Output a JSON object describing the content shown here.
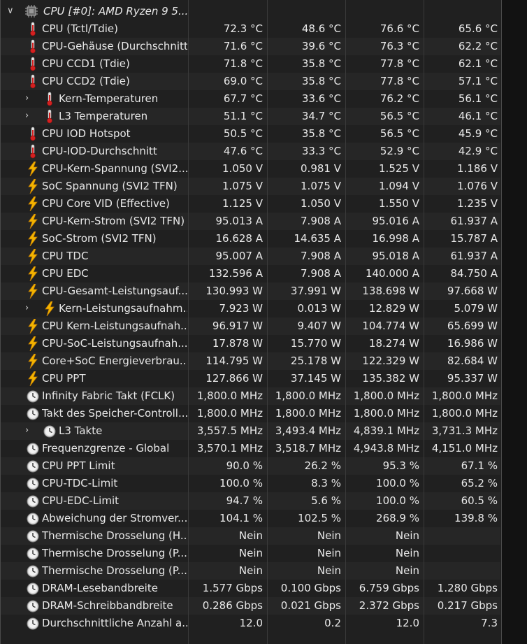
{
  "header": {
    "title": "CPU [#0]: AMD Ryzen 9 5..."
  },
  "rows": [
    {
      "name": "CPU (Tctl/Tdie)",
      "icon": "thermometer",
      "indent": 0,
      "v": [
        "72.3 °C",
        "48.6 °C",
        "76.6 °C",
        "65.6 °C"
      ]
    },
    {
      "name": "CPU-Gehäuse (Durchschnitt)",
      "icon": "thermometer",
      "indent": 0,
      "v": [
        "71.6 °C",
        "39.6 °C",
        "76.3 °C",
        "62.2 °C"
      ]
    },
    {
      "name": "CPU CCD1 (Tdie)",
      "icon": "thermometer",
      "indent": 0,
      "v": [
        "71.8 °C",
        "35.8 °C",
        "77.8 °C",
        "62.1 °C"
      ]
    },
    {
      "name": "CPU CCD2 (Tdie)",
      "icon": "thermometer",
      "indent": 0,
      "v": [
        "69.0 °C",
        "35.8 °C",
        "77.8 °C",
        "57.1 °C"
      ]
    },
    {
      "name": "Kern-Temperaturen",
      "icon": "thermometer",
      "indent": 1,
      "v": [
        "67.7 °C",
        "33.6 °C",
        "76.2 °C",
        "56.1 °C"
      ]
    },
    {
      "name": "L3 Temperaturen",
      "icon": "thermometer",
      "indent": 1,
      "v": [
        "51.1 °C",
        "34.7 °C",
        "56.5 °C",
        "46.1 °C"
      ]
    },
    {
      "name": "CPU IOD Hotspot",
      "icon": "thermometer",
      "indent": 0,
      "v": [
        "50.5 °C",
        "35.8 °C",
        "56.5 °C",
        "45.9 °C"
      ]
    },
    {
      "name": "CPU-IOD-Durchschnitt",
      "icon": "thermometer",
      "indent": 0,
      "v": [
        "47.6 °C",
        "33.3 °C",
        "52.9 °C",
        "42.9 °C"
      ]
    },
    {
      "name": "CPU-Kern-Spannung (SVI2...",
      "icon": "lightning",
      "indent": 0,
      "v": [
        "1.050 V",
        "0.981 V",
        "1.525 V",
        "1.186 V"
      ]
    },
    {
      "name": "SoC Spannung (SVI2 TFN)",
      "icon": "lightning",
      "indent": 0,
      "v": [
        "1.075 V",
        "1.075 V",
        "1.094 V",
        "1.076 V"
      ]
    },
    {
      "name": "CPU Core VID (Effective)",
      "icon": "lightning",
      "indent": 0,
      "v": [
        "1.125 V",
        "1.050 V",
        "1.550 V",
        "1.235 V"
      ]
    },
    {
      "name": "CPU-Kern-Strom (SVI2 TFN)",
      "icon": "lightning",
      "indent": 0,
      "v": [
        "95.013 A",
        "7.908 A",
        "95.016 A",
        "61.937 A"
      ]
    },
    {
      "name": "SoC-Strom (SVI2 TFN)",
      "icon": "lightning",
      "indent": 0,
      "v": [
        "16.628 A",
        "14.635 A",
        "16.998 A",
        "15.787 A"
      ]
    },
    {
      "name": "CPU TDC",
      "icon": "lightning",
      "indent": 0,
      "v": [
        "95.007 A",
        "7.908 A",
        "95.018 A",
        "61.937 A"
      ]
    },
    {
      "name": "CPU EDC",
      "icon": "lightning",
      "indent": 0,
      "v": [
        "132.596 A",
        "7.908 A",
        "140.000 A",
        "84.750 A"
      ]
    },
    {
      "name": "CPU-Gesamt-Leistungsauf...",
      "icon": "lightning",
      "indent": 0,
      "v": [
        "130.993 W",
        "37.991 W",
        "138.698 W",
        "97.668 W"
      ]
    },
    {
      "name": "Kern-Leistungsaufnahm...",
      "icon": "lightning",
      "indent": 1,
      "v": [
        "7.923 W",
        "0.013 W",
        "12.829 W",
        "5.079 W"
      ]
    },
    {
      "name": "CPU Kern-Leistungsaufnah...",
      "icon": "lightning",
      "indent": 0,
      "v": [
        "96.917 W",
        "9.407 W",
        "104.774 W",
        "65.699 W"
      ]
    },
    {
      "name": "CPU-SoC-Leistungsaufnah...",
      "icon": "lightning",
      "indent": 0,
      "v": [
        "17.878 W",
        "15.770 W",
        "18.274 W",
        "16.986 W"
      ]
    },
    {
      "name": "Core+SoC Energieverbrau...",
      "icon": "lightning",
      "indent": 0,
      "v": [
        "114.795 W",
        "25.178 W",
        "122.329 W",
        "82.684 W"
      ]
    },
    {
      "name": "CPU PPT",
      "icon": "lightning",
      "indent": 0,
      "v": [
        "127.866 W",
        "37.145 W",
        "135.382 W",
        "95.337 W"
      ]
    },
    {
      "name": "Infinity Fabric Takt (FCLK)",
      "icon": "clock",
      "indent": 0,
      "v": [
        "1,800.0 MHz",
        "1,800.0 MHz",
        "1,800.0 MHz",
        "1,800.0 MHz"
      ]
    },
    {
      "name": "Takt des Speicher-Controll...",
      "icon": "clock",
      "indent": 0,
      "v": [
        "1,800.0 MHz",
        "1,800.0 MHz",
        "1,800.0 MHz",
        "1,800.0 MHz"
      ]
    },
    {
      "name": "L3 Takte",
      "icon": "clock",
      "indent": 1,
      "v": [
        "3,557.5 MHz",
        "3,493.4 MHz",
        "4,839.1 MHz",
        "3,731.3 MHz"
      ]
    },
    {
      "name": "Frequenzgrenze - Global",
      "icon": "clock",
      "indent": 0,
      "v": [
        "3,570.1 MHz",
        "3,518.7 MHz",
        "4,943.8 MHz",
        "4,151.0 MHz"
      ]
    },
    {
      "name": "CPU PPT Limit",
      "icon": "clock",
      "indent": 0,
      "v": [
        "90.0 %",
        "26.2 %",
        "95.3 %",
        "67.1 %"
      ]
    },
    {
      "name": "CPU-TDC-Limit",
      "icon": "clock",
      "indent": 0,
      "v": [
        "100.0 %",
        "8.3 %",
        "100.0 %",
        "65.2 %"
      ]
    },
    {
      "name": "CPU-EDC-Limit",
      "icon": "clock",
      "indent": 0,
      "v": [
        "94.7 %",
        "5.6 %",
        "100.0 %",
        "60.5 %"
      ]
    },
    {
      "name": "Abweichung der Stromver...",
      "icon": "clock",
      "indent": 0,
      "v": [
        "104.1 %",
        "102.5 %",
        "268.9 %",
        "139.8 %"
      ]
    },
    {
      "name": "Thermische Drosselung (H...",
      "icon": "clock",
      "indent": 0,
      "v": [
        "Nein",
        "Nein",
        "Nein",
        ""
      ]
    },
    {
      "name": "Thermische Drosselung (P...",
      "icon": "clock",
      "indent": 0,
      "v": [
        "Nein",
        "Nein",
        "Nein",
        ""
      ]
    },
    {
      "name": "Thermische Drosselung (P...",
      "icon": "clock",
      "indent": 0,
      "v": [
        "Nein",
        "Nein",
        "Nein",
        ""
      ]
    },
    {
      "name": "DRAM-Lesebandbreite",
      "icon": "clock",
      "indent": 0,
      "v": [
        "1.577 Gbps",
        "0.100 Gbps",
        "6.759 Gbps",
        "1.280 Gbps"
      ]
    },
    {
      "name": "DRAM-Schreibbandbreite",
      "icon": "clock",
      "indent": 0,
      "v": [
        "0.286 Gbps",
        "0.021 Gbps",
        "2.372 Gbps",
        "0.217 Gbps"
      ]
    },
    {
      "name": "Durchschnittliche Anzahl a...",
      "icon": "clock",
      "indent": 0,
      "v": [
        "12.0",
        "0.2",
        "12.0",
        "7.3"
      ]
    }
  ]
}
